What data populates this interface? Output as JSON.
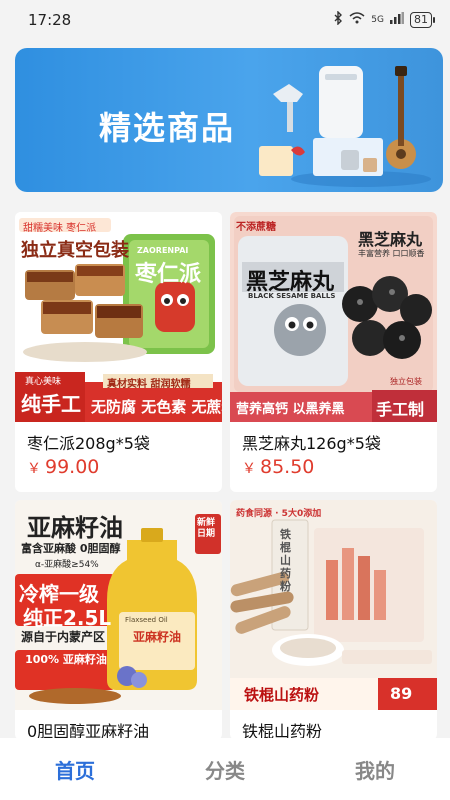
{
  "status_bar": {
    "time": "17:28",
    "signal_label": "5G",
    "battery": "81",
    "icons": [
      "bluetooth-icon",
      "wifi-icon",
      "signal-icon",
      "battery-icon"
    ]
  },
  "banner": {
    "title": "精选商品"
  },
  "products": [
    {
      "name": "枣仁派208g*5袋",
      "price": "99.00",
      "currency": "￥",
      "image_text": {
        "tag": "甜糯美味 枣仁派",
        "headline": "独立真空包装",
        "brand": "枣仁派",
        "brand_en": "ZAORENPAI",
        "side_note": "真心美味",
        "handmade": "纯手工",
        "features": "真材实料 甜润软糯",
        "claims": "无防腐 无色素 无蔗糖"
      }
    },
    {
      "name": "黑芝麻丸126g*5袋",
      "price": "85.50",
      "currency": "￥",
      "image_text": {
        "tag": "不添蔗糖",
        "headline": "黑芝麻丸",
        "brand": "黑芝麻丸",
        "brand_en": "BLACK SESAME BALLS",
        "sub1": "丰富营养 口口顺香",
        "sub2": "独立包装",
        "slogan": "营养高钙 以黑养黑",
        "handmade": "手工制"
      }
    },
    {
      "name": "0胆固醇亚麻籽油",
      "image_text": {
        "headline": "亚麻籽油",
        "sub1": "富含亚麻酸 0胆固醇",
        "sub2": "α-亚麻酸≥54%",
        "cold_press": "冷榨一级",
        "purity": "纯正2.5L",
        "origin": "源自于内蒙产区",
        "badge": "100% 亚麻籽油",
        "new_tag": "新鲜日期",
        "bottle_label": "亚麻籽油",
        "bottle_en": "Flaxseed Oil"
      }
    },
    {
      "name": "铁棍山药粉",
      "image_text": {
        "tag": "药食同源 · 5大0添加",
        "headline": "铁棍山药粉",
        "box_text": "铁棍山药粉",
        "price_tag": "89"
      }
    }
  ],
  "tabs": [
    {
      "label": "首页",
      "active": true
    },
    {
      "label": "分类",
      "active": false
    },
    {
      "label": "我的",
      "active": false
    }
  ],
  "colors": {
    "accent": "#2c6fd9",
    "price": "#e03c2e",
    "banner": "#3e94dc"
  }
}
